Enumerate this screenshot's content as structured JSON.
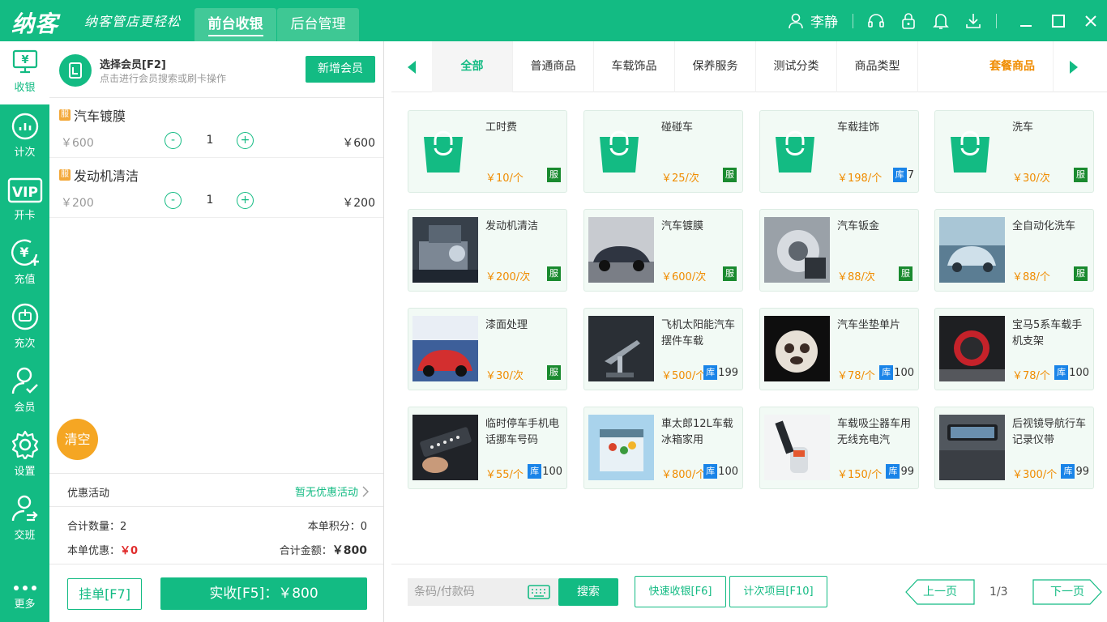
{
  "app": {
    "logo": "纳客",
    "slogan": "纳客管店更轻松",
    "tabs": [
      "前台收银",
      "后台管理"
    ],
    "user": "李静"
  },
  "nav": [
    {
      "label": "收银",
      "icon": "cashier-icon",
      "active": true
    },
    {
      "label": "计次",
      "icon": "chart-icon"
    },
    {
      "label": "开卡",
      "icon": "vip-icon"
    },
    {
      "label": "充值",
      "icon": "recharge-icon"
    },
    {
      "label": "充次",
      "icon": "recharge-times-icon"
    },
    {
      "label": "会员",
      "icon": "member-icon"
    },
    {
      "label": "设置",
      "icon": "gear-icon"
    },
    {
      "label": "交班",
      "icon": "handover-icon"
    },
    {
      "label": "更多",
      "icon": "more-icon"
    }
  ],
  "cart": {
    "member_title": "选择会员[F2]",
    "member_hint": "点击进行会员搜索或刷卡操作",
    "add_member": "新增会员",
    "items": [
      {
        "name": "汽车镀膜",
        "tag": "服",
        "price": "￥600",
        "qty": "1",
        "total": "￥600"
      },
      {
        "name": "发动机清洁",
        "tag": "服",
        "price": "￥200",
        "qty": "1",
        "total": "￥200"
      }
    ],
    "clear": "清空",
    "promo_label": "优惠活动",
    "promo_value": "暂无优惠活动",
    "total_qty_label": "合计数量：",
    "total_qty": "2",
    "points_label": "本单积分：",
    "points": "0",
    "discount_label": "本单优惠：",
    "discount": "￥0",
    "amount_label": "合计金额：",
    "amount": "￥800",
    "hold": "挂单[F7]",
    "pay": "实收[F5]：￥800"
  },
  "categories": [
    "全部",
    "普通商品",
    "车载饰品",
    "保养服务",
    "测试分类",
    "商品类型",
    "套餐商品"
  ],
  "products": [
    {
      "name": "工时费",
      "price": "￥10/个",
      "tag": "服",
      "img": "bag"
    },
    {
      "name": "碰碰车",
      "price": "￥25/次",
      "tag": "服",
      "img": "bag"
    },
    {
      "name": "车载挂饰",
      "price": "￥198/个",
      "tag": "库",
      "stock": "7",
      "img": "bag"
    },
    {
      "name": "洗车",
      "price": "￥30/次",
      "tag": "服",
      "img": "bag"
    },
    {
      "name": "发动机清洁",
      "price": "￥200/次",
      "tag": "服",
      "img": "engine"
    },
    {
      "name": "汽车镀膜",
      "price": "￥600/次",
      "tag": "服",
      "img": "car"
    },
    {
      "name": "汽车钣金",
      "price": "￥88/次",
      "tag": "服",
      "img": "metal"
    },
    {
      "name": "全自动化洗车",
      "price": "￥88/个",
      "tag": "服",
      "img": "wash"
    },
    {
      "name": "漆面处理",
      "price": "￥30/次",
      "tag": "服",
      "img": "paint"
    },
    {
      "name": "飞机太阳能汽车摆件车载",
      "price": "￥500/个",
      "tag": "库",
      "stock": "199",
      "img": "plane"
    },
    {
      "name": "汽车坐垫单片",
      "price": "￥78/个",
      "tag": "库",
      "stock": "100",
      "img": "cushion"
    },
    {
      "name": "宝马5系车载手机支架",
      "price": "￥78/个",
      "tag": "库",
      "stock": "100",
      "img": "holder"
    },
    {
      "name": "临时停车手机电话挪车号码",
      "price": "￥55/个",
      "tag": "库",
      "stock": "100",
      "img": "parking"
    },
    {
      "name": "車太郎12L车载冰箱家用",
      "price": "￥800/个",
      "tag": "库",
      "stock": "100",
      "img": "fridge"
    },
    {
      "name": "车载吸尘器车用无线充电汽",
      "price": "￥150/个",
      "tag": "库",
      "stock": "99",
      "img": "vacuum"
    },
    {
      "name": "后视镜导航行车记录仪带",
      "price": "￥300/个",
      "tag": "库",
      "stock": "99",
      "img": "mirror"
    }
  ],
  "bottom": {
    "barcode_placeholder": "条码/付款码",
    "search": "搜索",
    "quick_pay": "快速收银[F6]",
    "count_items": "计次项目[F10]",
    "prev": "上一页",
    "page": "1/3",
    "next": "下一页"
  },
  "colors": {
    "brand": "#13bb83",
    "price": "#f08c00",
    "service_tag": "#1a8a2f",
    "stock_tag": "#1a84e8",
    "clear": "#f5a623"
  }
}
